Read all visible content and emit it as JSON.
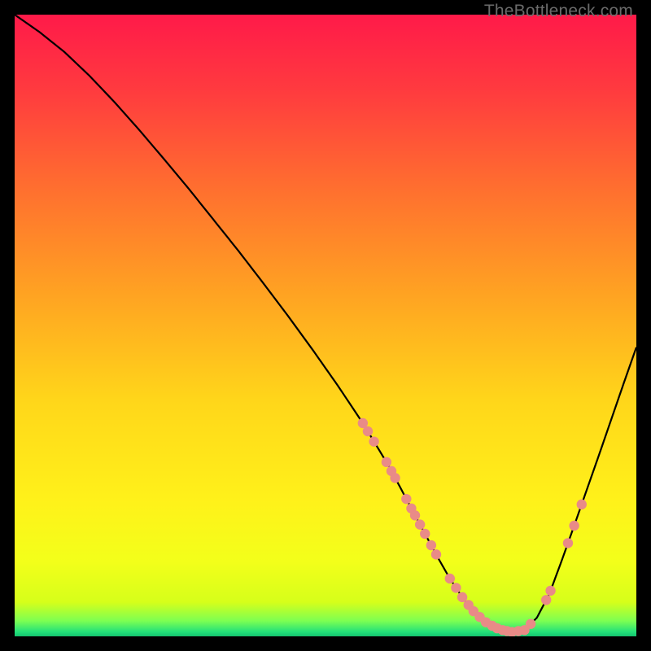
{
  "watermark": "TheBottleneck.com",
  "gradient": {
    "stops": [
      {
        "offset": 0.0,
        "color": "#ff1a49"
      },
      {
        "offset": 0.12,
        "color": "#ff3a3f"
      },
      {
        "offset": 0.28,
        "color": "#ff6f2f"
      },
      {
        "offset": 0.45,
        "color": "#ffa322"
      },
      {
        "offset": 0.62,
        "color": "#ffd61a"
      },
      {
        "offset": 0.78,
        "color": "#fff11a"
      },
      {
        "offset": 0.88,
        "color": "#f3ff1a"
      },
      {
        "offset": 0.945,
        "color": "#d6ff1a"
      },
      {
        "offset": 0.975,
        "color": "#7dff52"
      },
      {
        "offset": 0.993,
        "color": "#22e07a"
      },
      {
        "offset": 1.0,
        "color": "#14c46e"
      }
    ]
  },
  "curve_color": "#000000",
  "curve_width": 2.2,
  "marker_color": "#e98b87",
  "chart_data": {
    "type": "line",
    "title": "",
    "xlabel": "",
    "ylabel": "",
    "xlim": [
      0,
      100
    ],
    "ylim": [
      0,
      100
    ],
    "series": [
      {
        "name": "bottleneck-curve",
        "x": [
          0,
          4,
          8,
          12,
          16,
          20,
          24,
          28,
          32,
          36,
          40,
          44,
          48,
          52,
          56,
          58,
          60,
          62,
          64,
          66,
          68,
          70,
          72,
          74,
          76,
          78,
          80,
          82,
          84,
          86,
          88,
          90,
          92,
          94,
          96,
          98,
          100
        ],
        "y": [
          100,
          97.2,
          94.0,
          90.2,
          86.0,
          81.5,
          76.8,
          72.0,
          67.0,
          62.0,
          56.8,
          51.5,
          46.0,
          40.3,
          34.3,
          31.0,
          27.7,
          24.0,
          20.2,
          16.5,
          12.8,
          9.3,
          6.3,
          3.8,
          2.1,
          1.1,
          0.7,
          1.0,
          3.0,
          6.8,
          12.2,
          17.8,
          23.5,
          29.2,
          35.0,
          40.8,
          46.5
        ]
      }
    ],
    "markers_x": [
      56.0,
      56.8,
      57.8,
      59.8,
      60.6,
      61.2,
      63.0,
      63.8,
      64.4,
      65.2,
      66.0,
      67.0,
      67.8,
      70.0,
      71.0,
      72.0,
      73.0,
      73.8,
      74.8,
      75.8,
      76.8,
      77.6,
      78.5,
      79.2,
      80.0,
      81.0,
      82.0,
      83.0,
      85.5,
      86.2,
      89.0,
      90.0,
      91.2
    ]
  }
}
